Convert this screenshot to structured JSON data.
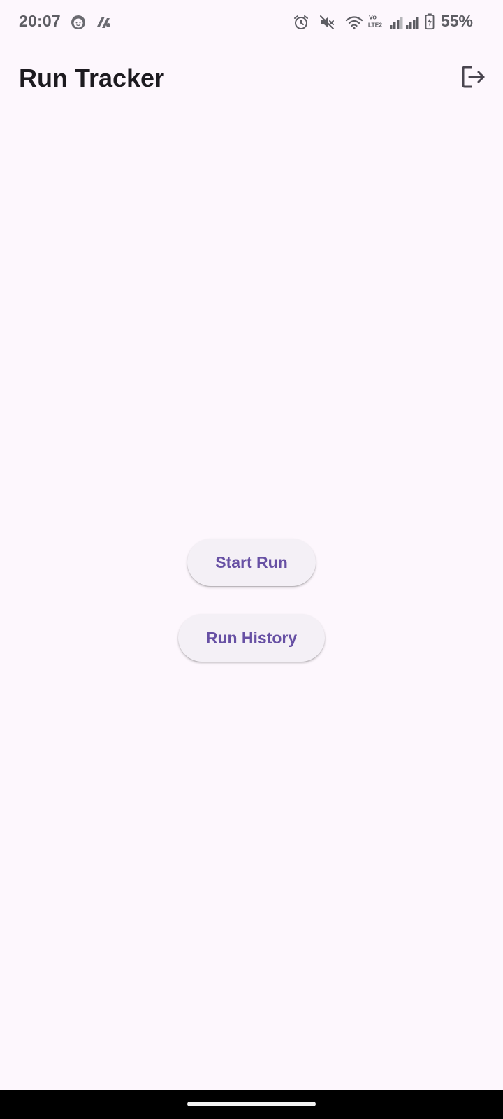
{
  "status_bar": {
    "time": "20:07",
    "battery_percent": "55%",
    "network_label": "Vo LTE2",
    "icons": [
      "face-notification-icon",
      "app-notification-icon",
      "alarm-icon",
      "mute-icon",
      "wifi-icon",
      "volte-icon",
      "signal-icon",
      "signal-icon",
      "battery-charging-icon"
    ]
  },
  "app_bar": {
    "title": "Run Tracker",
    "action_icon": "logout-icon"
  },
  "main": {
    "start_run_label": "Start Run",
    "run_history_label": "Run History"
  },
  "colors": {
    "background": "#fdf7fd",
    "button_bg": "#f4f0f6",
    "button_text": "#6750a4",
    "title_text": "#1d1b20"
  }
}
